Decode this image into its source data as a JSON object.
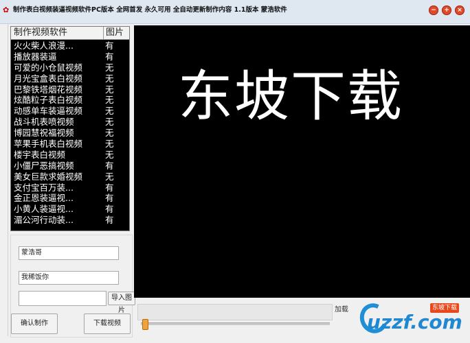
{
  "window": {
    "title": "制作表白视频装逼视频软件PC版本 全网首发  永久可用 全自动更新制作内容 1.1版本  蒙浩软件",
    "app_icon": "app-glyph",
    "controls": [
      "minimize",
      "maximize",
      "close"
    ]
  },
  "list": {
    "headers": {
      "name": "制作视频软件",
      "picture": "图片"
    },
    "rows": [
      {
        "name": "火火柴人浪漫...",
        "picture": "有"
      },
      {
        "name": "播放器装逼",
        "picture": "有"
      },
      {
        "name": "可爱的小仓鼠视频",
        "picture": "无"
      },
      {
        "name": "月光宝盒表白视频",
        "picture": "无"
      },
      {
        "name": "巴黎铁塔烟花视频",
        "picture": "无"
      },
      {
        "name": "炫酷粒子表白视频",
        "picture": "无"
      },
      {
        "name": "动感单车装逼视频",
        "picture": "无"
      },
      {
        "name": "战斗机表喷视频",
        "picture": "无"
      },
      {
        "name": "博园慧祝福视频",
        "picture": "无"
      },
      {
        "name": "苹果手机表白视频",
        "picture": "无"
      },
      {
        "name": "楼宇表白视频",
        "picture": "无"
      },
      {
        "name": "小僵尸恶搞视频",
        "picture": "有"
      },
      {
        "name": "美女巨款求婚视频",
        "picture": "无"
      },
      {
        "name": "支付宝百万装...",
        "picture": "有"
      },
      {
        "name": "金正恩装逼视...",
        "picture": "有"
      },
      {
        "name": "小黄人装逼视...",
        "picture": "有"
      },
      {
        "name": "湄公河行动装...",
        "picture": "有"
      }
    ]
  },
  "form": {
    "name_value": "蒙浩哥",
    "message_value": "我稀饭你",
    "image_path_value": "",
    "import_image_label": "导入图片",
    "confirm_label": "确认制作",
    "download_label": "下载视频"
  },
  "video": {
    "watermark": "东坡下载"
  },
  "player": {
    "speed_label": "加载"
  },
  "brand": {
    "logo_text": "uzzf.com",
    "badge": "东坡下载"
  }
}
